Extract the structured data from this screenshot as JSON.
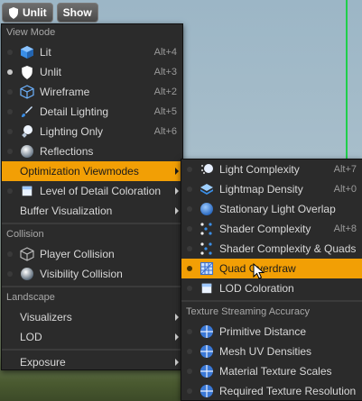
{
  "toolbar": {
    "view_mode_button": "Unlit",
    "show_button": "Show"
  },
  "main_menu": {
    "view_mode_header": "View Mode",
    "view_modes": [
      {
        "label": "Lit",
        "shortcut": "Alt+4",
        "icon": "cube-icon",
        "selected": false
      },
      {
        "label": "Unlit",
        "shortcut": "Alt+3",
        "icon": "shield-icon",
        "selected": true
      },
      {
        "label": "Wireframe",
        "shortcut": "Alt+2",
        "icon": "wireframe-cube-icon",
        "selected": false
      },
      {
        "label": "Detail Lighting",
        "shortcut": "Alt+5",
        "icon": "brush-icon",
        "selected": false
      },
      {
        "label": "Lighting Only",
        "shortcut": "Alt+6",
        "icon": "bulb-icon",
        "selected": false
      },
      {
        "label": "Reflections",
        "shortcut": "",
        "icon": "sphere-icon",
        "selected": false
      }
    ],
    "optimization_label": "Optimization Viewmodes",
    "lod_coloration_label": "Level of Detail Coloration",
    "buffer_visualization_label": "Buffer Visualization",
    "collision_header": "Collision",
    "collision_items": [
      {
        "label": "Player Collision",
        "icon": "wire-box-icon"
      },
      {
        "label": "Visibility Collision",
        "icon": "sphere-icon"
      }
    ],
    "landscape_header": "Landscape",
    "visualizers_label": "Visualizers",
    "lod_label": "LOD",
    "exposure_label": "Exposure"
  },
  "sub_menu": {
    "items": [
      {
        "label": "Light Complexity",
        "shortcut": "Alt+7",
        "icon": "light-complexity-icon"
      },
      {
        "label": "Lightmap Density",
        "shortcut": "Alt+0",
        "icon": "lightmap-density-icon"
      },
      {
        "label": "Stationary Light Overlap",
        "shortcut": "",
        "icon": "blue-sphere-icon"
      },
      {
        "label": "Shader Complexity",
        "shortcut": "Alt+8",
        "icon": "dots-icon"
      },
      {
        "label": "Shader Complexity & Quads",
        "shortcut": "",
        "icon": "dots-icon"
      },
      {
        "label": "Quad Overdraw",
        "shortcut": "",
        "icon": "grid-icon",
        "highlighted": true
      },
      {
        "label": "LOD Coloration",
        "shortcut": "",
        "icon": "cube-icon"
      }
    ],
    "texture_header": "Texture Streaming Accuracy",
    "texture_items": [
      {
        "label": "Primitive Distance",
        "icon": "crosshair-icon"
      },
      {
        "label": "Mesh UV Densities",
        "icon": "crosshair-icon"
      },
      {
        "label": "Material Texture Scales",
        "icon": "crosshair-icon"
      },
      {
        "label": "Required Texture Resolution",
        "icon": "crosshair-icon"
      }
    ]
  },
  "colors": {
    "highlight": "#f29f05",
    "menu_bg": "#2b2b2b",
    "accent_blue": "#3a8ee6"
  }
}
